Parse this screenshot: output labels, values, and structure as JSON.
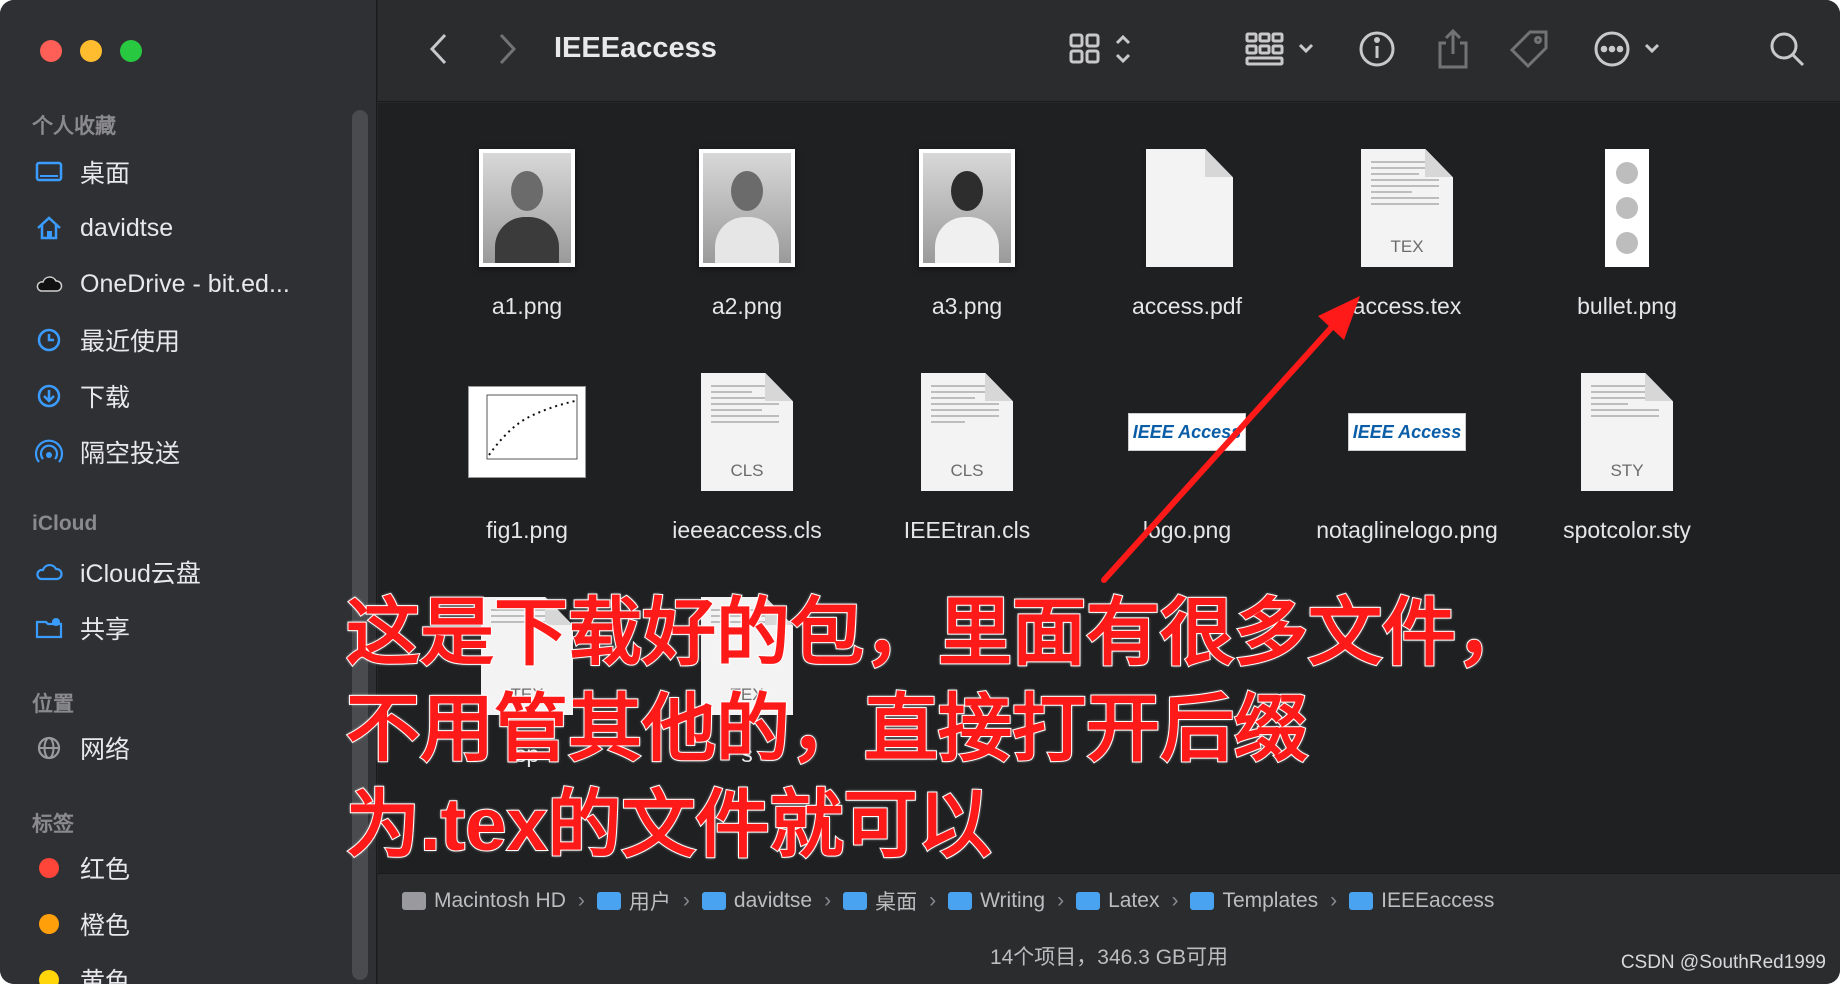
{
  "window": {
    "title": "IEEEaccess"
  },
  "sidebar": {
    "favorites_label": "个人收藏",
    "favorites": [
      {
        "label": "桌面",
        "icon": "desktop-icon"
      },
      {
        "label": "davidtse",
        "icon": "home-icon"
      },
      {
        "label": "OneDrive - bit.ed...",
        "icon": "cloud-icon"
      },
      {
        "label": "最近使用",
        "icon": "clock-icon"
      },
      {
        "label": "下载",
        "icon": "download-icon"
      },
      {
        "label": "隔空投送",
        "icon": "airdrop-icon"
      }
    ],
    "icloud_label": "iCloud",
    "icloud": [
      {
        "label": "iCloud云盘",
        "icon": "icloud-icon"
      },
      {
        "label": "共享",
        "icon": "shared-folder-icon"
      }
    ],
    "locations_label": "位置",
    "locations": [
      {
        "label": "网络",
        "icon": "network-icon"
      }
    ],
    "tags_label": "标签",
    "tags": [
      {
        "label": "红色",
        "color": "#ff453a"
      },
      {
        "label": "橙色",
        "color": "#ff9f0a"
      },
      {
        "label": "黄色",
        "color": "#ffd60a"
      }
    ]
  },
  "files": [
    {
      "name": "a1.png",
      "kind": "photo"
    },
    {
      "name": "a2.png",
      "kind": "photo"
    },
    {
      "name": "a3.png",
      "kind": "photo"
    },
    {
      "name": "access.pdf",
      "kind": "pdf"
    },
    {
      "name": "access.tex",
      "kind": "doc",
      "ext": "TEX"
    },
    {
      "name": "bullet.png",
      "kind": "bullet"
    },
    {
      "name": "fig1.png",
      "kind": "fig"
    },
    {
      "name": "ieeeaccess.cls",
      "kind": "doc",
      "ext": "CLS"
    },
    {
      "name": "IEEEtran.cls",
      "kind": "doc",
      "ext": "CLS"
    },
    {
      "name": "logo.png",
      "kind": "logo",
      "logo_text": "IEEE Access"
    },
    {
      "name": "notaglinelogo.png",
      "kind": "logo",
      "logo_text": "IEEE Access"
    },
    {
      "name": "spotcolor.sty",
      "kind": "doc",
      "ext": "STY"
    },
    {
      "name": "sp",
      "kind": "doc",
      "ext": "TEX"
    },
    {
      "name": "s",
      "kind": "doc",
      "ext": "TEX"
    }
  ],
  "pathbar": [
    {
      "label": "Macintosh HD"
    },
    {
      "label": "用户"
    },
    {
      "label": "davidtse"
    },
    {
      "label": "桌面"
    },
    {
      "label": "Writing"
    },
    {
      "label": "Latex"
    },
    {
      "label": "Templates"
    },
    {
      "label": "IEEEaccess"
    }
  ],
  "status": "14个项目，346.3 GB可用",
  "annotation": {
    "lines": [
      "这是下载好的包，里面有很多文件，",
      "不用管其他的，直接打开后缀",
      "为.tex的文件就可以"
    ],
    "color": "#ff1a1a"
  },
  "watermark": "CSDN @SouthRed1999"
}
